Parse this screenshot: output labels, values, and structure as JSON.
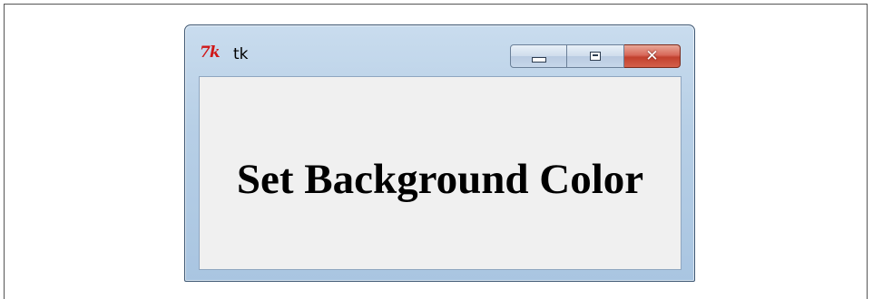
{
  "window": {
    "title": "tk",
    "logo_text": "7k"
  },
  "titlebar_buttons": {
    "minimize_icon": "minimize-icon",
    "maximize_icon": "maximize-icon",
    "close_icon": "close-icon",
    "close_glyph": "✕"
  },
  "content": {
    "label": "Set Background Color"
  },
  "colors": {
    "client_background": "#f0f0f0",
    "close_button": "#c2402e",
    "logo": "#d01818"
  }
}
